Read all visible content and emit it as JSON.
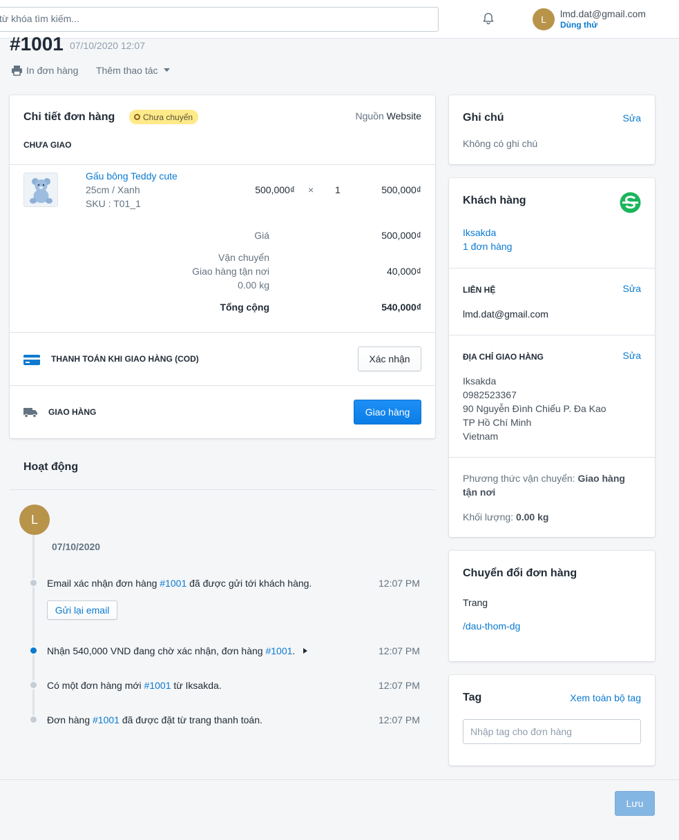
{
  "topbar": {
    "search_placeholder": "từ khóa tìm kiếm...",
    "user_initial": "L",
    "user_email": "lmd.dat@gmail.com",
    "user_plan": "Dùng thử"
  },
  "order": {
    "number": "#1001",
    "date": "07/10/2020 12:07",
    "print_label": "In đơn hàng",
    "more_label": "Thêm thao tác"
  },
  "detail": {
    "title": "Chi tiết đơn hàng",
    "status_badge": "Chưa chuyển",
    "source_label": "Nguồn",
    "source_value": "Website",
    "section_label": "CHƯA GIAO",
    "item": {
      "name": "Gấu bông Teddy cute",
      "variant": "25cm / Xanh",
      "sku": "SKU : T01_1",
      "price": "500,000₫",
      "times": "×",
      "qty": "1",
      "total": "500,000₫"
    },
    "summary": {
      "price_label": "Giá",
      "price_value": "500,000₫",
      "shipping_label": "Vận chuyển",
      "shipping_method": "Giao hàng tận nơi",
      "shipping_weight": "0.00 kg",
      "shipping_value": "40,000₫",
      "total_label": "Tổng cộng",
      "total_value": "540,000₫"
    },
    "payment": {
      "label": "THANH TOÁN KHI GIAO HÀNG (COD)",
      "button": "Xác nhận"
    },
    "delivery": {
      "label": "GIAO HÀNG",
      "button": "Giao hàng"
    }
  },
  "activity": {
    "title": "Hoạt động",
    "avatar_initial": "L",
    "date": "07/10/2020",
    "events": [
      {
        "before": "Email xác nhận đơn hàng ",
        "link": "#1001",
        "after": " đã được gửi tới khách hàng.",
        "time": "12:07 PM"
      },
      {
        "before": "Nhận 540,000 VND đang chờ xác nhận, đơn hàng ",
        "link": "#1001",
        "after": ".",
        "time": "12:07 PM"
      },
      {
        "before": "Có một đơn hàng mới ",
        "link": "#1001",
        "after": " từ Iksakda.",
        "time": "12:07 PM"
      },
      {
        "before": "Đơn hàng ",
        "link": "#1001",
        "after": " đã được đặt từ trang thanh toán.",
        "time": "12:07 PM"
      }
    ],
    "resend_button": "Gửi lại email"
  },
  "notes": {
    "title": "Ghi chú",
    "edit": "Sửa",
    "text": "Không có ghi chú"
  },
  "customer": {
    "title": "Khách hàng",
    "name": "Iksakda",
    "orders": "1 đơn hàng",
    "contact_label": "LIÊN HỆ",
    "contact_edit": "Sửa",
    "email": "lmd.dat@gmail.com",
    "address_label": "ĐỊA CHỈ GIAO HÀNG",
    "address_edit": "Sửa",
    "address_lines": [
      "Iksakda",
      "0982523367",
      "90 Nguyễn Đình Chiểu P. Đa Kao",
      "TP Hồ Chí Minh",
      "Vietnam"
    ],
    "shipping_method_label": "Phương thức vận chuyển:",
    "shipping_method_value": "Giao hàng tận nơi",
    "weight_label": "Khối lượng:",
    "weight_value": "0.00 kg"
  },
  "conversion": {
    "title": "Chuyển đổi đơn hàng",
    "page_label": "Trang",
    "page_link": "/dau-thom-dg"
  },
  "tags": {
    "title": "Tag",
    "view_all": "Xem toàn bộ tag",
    "input_placeholder": "Nhập tag cho đơn hàng"
  },
  "footer": {
    "save": "Lưu"
  },
  "colors": {
    "accent": "#0a7ad1",
    "badge_bg": "#ffea8a",
    "avatar": "#b8934a",
    "brand_green": "#1bb55c"
  }
}
